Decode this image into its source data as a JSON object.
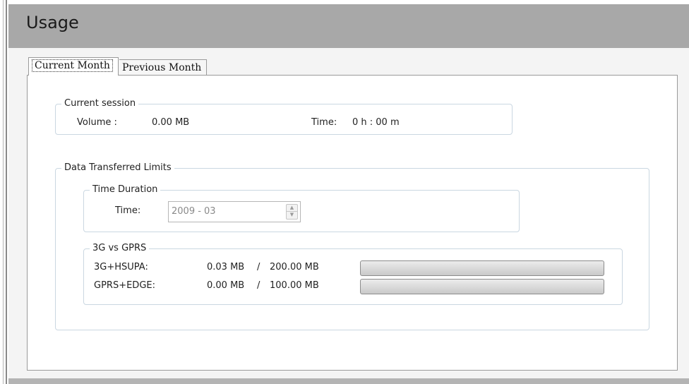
{
  "header": {
    "title": "Usage"
  },
  "tabs": [
    {
      "label": "Current Month",
      "active": true
    },
    {
      "label": "Previous Month",
      "active": false
    }
  ],
  "current_session": {
    "legend": "Current session",
    "volume_label": "Volume :",
    "volume_value": "0.00 MB",
    "time_label": "Time:",
    "time_value": "0 h : 00 m"
  },
  "limits": {
    "legend": "Data Transferred  Limits",
    "time_duration": {
      "legend": "Time Duration",
      "time_label": "Time:",
      "time_value": "2009 - 03"
    },
    "network": {
      "legend": "3G vs GPRS",
      "rows": [
        {
          "label": "3G+HSUPA:",
          "used": "0.03 MB",
          "separator": "/",
          "limit": "200.00 MB",
          "fraction": 0.00015
        },
        {
          "label": "GPRS+EDGE:",
          "used": "0.00 MB",
          "separator": "/",
          "limit": "100.00 MB",
          "fraction": 0.0
        }
      ]
    }
  },
  "icons": {
    "spin_up": "spin-up-arrow-icon",
    "spin_down": "spin-down-arrow-icon"
  },
  "colors": {
    "header_bg": "#a8a8a8",
    "group_border": "#cad7e1",
    "progress_fill": "#3aa93a"
  }
}
